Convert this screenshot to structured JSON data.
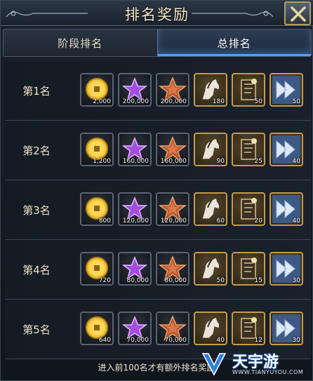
{
  "title": "排名奖励",
  "tabs": [
    {
      "label": "阶段排名",
      "active": false
    },
    {
      "label": "总排名",
      "active": true
    }
  ],
  "rows": [
    {
      "rank": "第1名",
      "quantities": [
        "2,000",
        "200,000",
        "200,000",
        "180",
        "50",
        "50"
      ]
    },
    {
      "rank": "第2名",
      "quantities": [
        "1,200",
        "160,000",
        "160,000",
        "90",
        "25",
        "40"
      ]
    },
    {
      "rank": "第3名",
      "quantities": [
        "800",
        "120,000",
        "120,000",
        "60",
        "20",
        "40"
      ]
    },
    {
      "rank": "第4名",
      "quantities": [
        "720",
        "80,000",
        "80,000",
        "50",
        "15",
        "30"
      ]
    },
    {
      "rank": "第5名",
      "quantities": [
        "640",
        "70,000",
        "70,000",
        "40",
        "12",
        "30"
      ]
    }
  ],
  "item_icons": [
    "gold-coin-icon",
    "purple-star-icon",
    "bronze-star-icon",
    "horse-icon",
    "scroll-icon",
    "speedup-icon"
  ],
  "footer": "进入前100名才有额外排名奖励",
  "watermark": {
    "text": "天宇游",
    "url": "WWW.TIANYUYOU.COM"
  },
  "colors": {
    "accent": "#4da3ff",
    "gold_frame": "#c59b4a",
    "text": "#e9dcc0"
  }
}
